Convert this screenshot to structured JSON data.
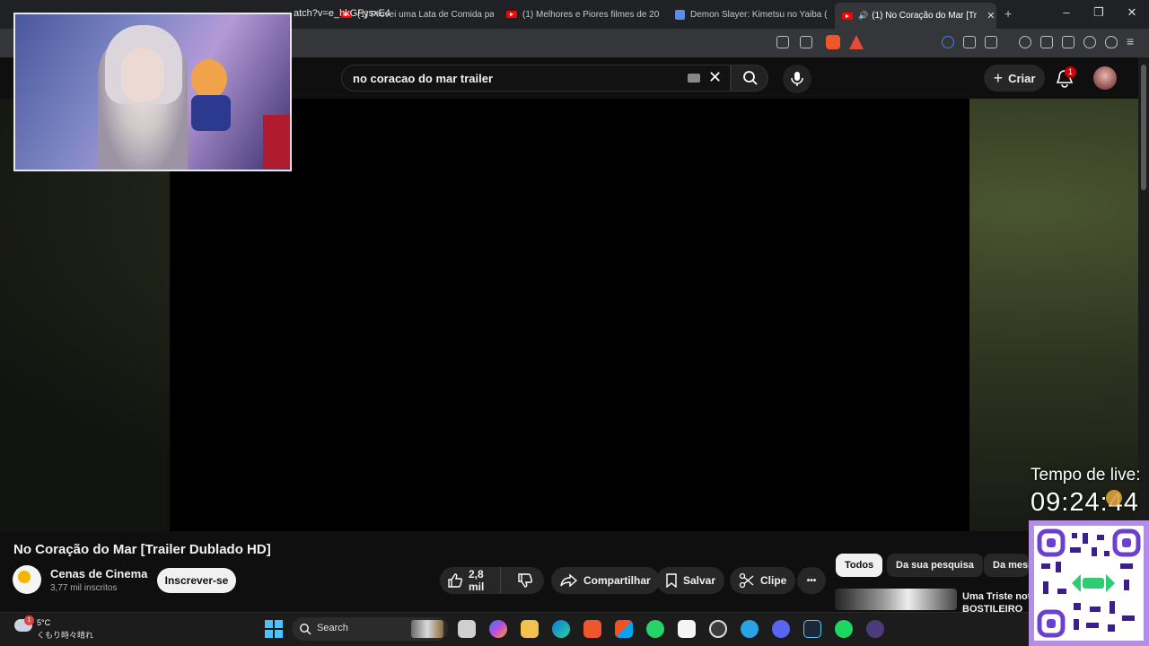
{
  "browser": {
    "tabs": [
      {
        "label": "(1) Provei uma Lata de Comida pa",
        "icon": "youtube-icon"
      },
      {
        "label": "(1) Melhores e Piores filmes de 20",
        "icon": "youtube-icon"
      },
      {
        "label": "Demon Slayer: Kimetsu no Yaiba (",
        "icon": "document-icon"
      },
      {
        "label": "(1) No Coração do Mar [Tr",
        "icon": "youtube-icon",
        "active": true
      }
    ],
    "new_tab": "+",
    "tab_close": "✕",
    "url": "atch?v=e_hkGFysxE4"
  },
  "youtube": {
    "search_value": "no coracao do mar trailer",
    "create_label": "Criar",
    "notification_count": "1",
    "video": {
      "title": "No Coração do Mar [Trailer Dublado HD]",
      "channel_name": "Cenas de Cinema",
      "subscribers": "3,77 mil inscritos",
      "subscribe_label": "Inscrever-se",
      "likes": "2,8 mil",
      "share_label": "Compartilhar",
      "save_label": "Salvar",
      "clip_label": "Clipe",
      "more_label": "•••"
    },
    "chips": [
      "Todos",
      "Da sua pesquisa",
      "Da mesi"
    ],
    "recommendation": {
      "title": "Uma Triste not BOSTILEIRO"
    }
  },
  "overlay": {
    "timer_label": "Tempo de live:",
    "timer_value": "09:24:44"
  },
  "taskbar": {
    "weather_temp": "5°C",
    "weather_desc": "くもり時々晴れ",
    "weather_badge": "1",
    "search_label": "Search"
  }
}
